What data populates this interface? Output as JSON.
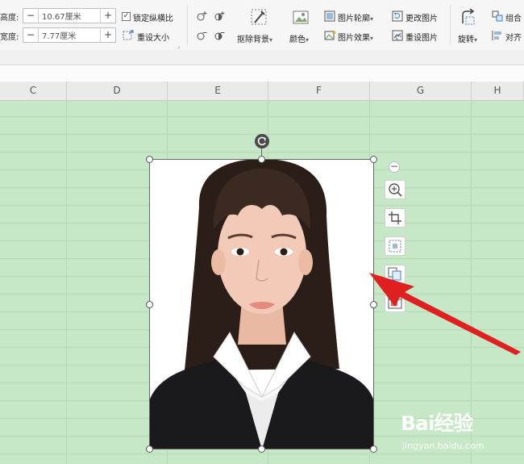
{
  "ribbon": {
    "height_label": "高度:",
    "width_label": "宽度:",
    "height_value": "10.67厘米",
    "width_value": "7.77厘米",
    "minus": "−",
    "plus": "+",
    "lock_ratio_label": "锁定纵横比",
    "lock_ratio_checked": "✓",
    "reset_size_label": "重设大小",
    "remove_bg_label": "抠除背景",
    "color_label": "颜色",
    "outline_label": "图片轮廓",
    "effects_label": "图片效果",
    "change_picture_label": "更改图片",
    "reset_picture_label": "重设图片",
    "rotate_label": "旋转",
    "group_label": "组合",
    "align_label": "对齐",
    "dropdown_arrow": "▾"
  },
  "columns": [
    "C",
    "D",
    "E",
    "F",
    "G",
    "H"
  ],
  "floating_toolbar": {
    "collapse": "−",
    "icons": [
      "zoom-in-icon",
      "crop-icon",
      "image-convert-icon",
      "image-copy-icon",
      "image-layout-icon"
    ]
  },
  "watermark": {
    "brand": "Bai经验",
    "url": "jingyan.baidu.com"
  },
  "colors": {
    "sheet_bg": "#c7e8c6",
    "gridline": "#b5d7b3",
    "arrow": "#e02020",
    "ribbon_bg": "#f6f6f6"
  }
}
